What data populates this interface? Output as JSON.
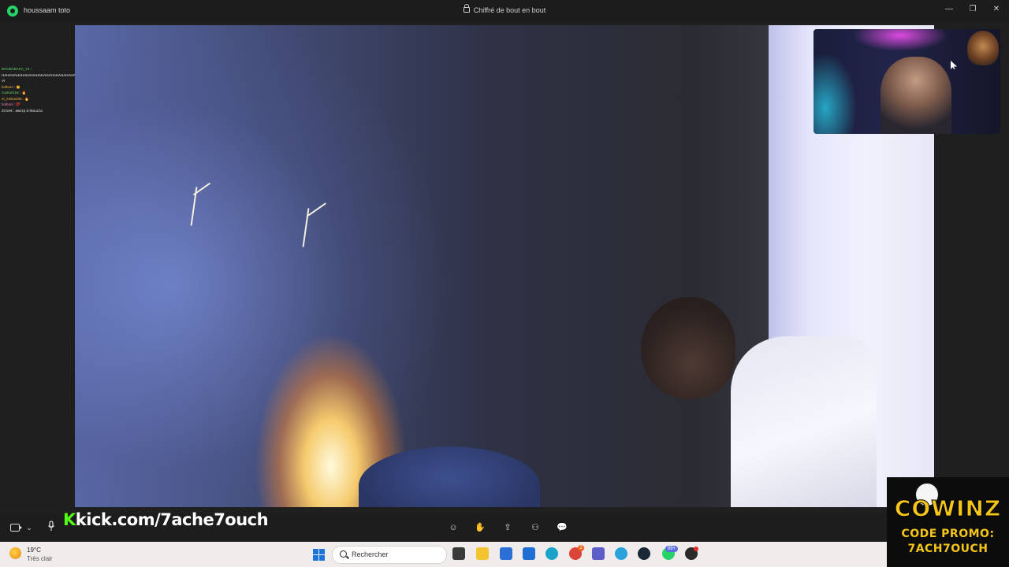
{
  "window": {
    "contact_name": "houssaam toto",
    "encryption_label": "Chiffré de bout en bout",
    "controls": {
      "minimize": "—",
      "restore": "❐",
      "close": "✕"
    }
  },
  "chat": [
    {
      "user": "BOUBABAKA_V1",
      "sep": " : ",
      "message": "HAHAHAHAHAHAHAHAHAHAHAHAHAHAHAHAHAHAHAHAHAHA VI"
    },
    {
      "user": "bolboni",
      "sep": " : ",
      "message": "👏"
    },
    {
      "user": "zuukuriza4",
      "sep": " : ",
      "message": "🔥"
    },
    {
      "user": "el_mekoni00",
      "sep": " : ",
      "message": "🔥"
    },
    {
      "user": "bolboni",
      "sep": " : ",
      "message": "💯"
    },
    {
      "user": "2izizek",
      "sep": " : ",
      "message": "awzzp d skouzza"
    }
  ],
  "overlay": {
    "kick_text": "kick.com/7ache7ouch",
    "promo_brand": "COWINZ",
    "promo_line1": "CODE PROMO:",
    "promo_line2": "7ACH7OUCH"
  },
  "call_controls": {
    "camera_chevron": "⌄",
    "actions": [
      "☺",
      "✋",
      "⇪",
      "⚇",
      "💬"
    ]
  },
  "taskbar": {
    "weather_temp": "19°C",
    "weather_desc": "Très clair",
    "search_placeholder": "Rechercher",
    "badges": {
      "chrome": "2",
      "whatsapp": "99+"
    },
    "apps": [
      "task-view",
      "file-explorer",
      "microsoft-store",
      "outlook",
      "edge",
      "chrome",
      "teams",
      "telegram",
      "steam",
      "whatsapp",
      "obs"
    ],
    "app_colors": {
      "task-view": "#3a3a3a",
      "file-explorer": "#f4c430",
      "microsoft-store": "#2a6fd6",
      "outlook": "#1e6fd1",
      "edge": "#1aa3c8",
      "chrome": "#db4437",
      "teams": "#5b5fc7",
      "telegram": "#2aa1da",
      "steam": "#1b2838",
      "whatsapp": "#25d366",
      "obs": "#2b2b2b"
    }
  }
}
